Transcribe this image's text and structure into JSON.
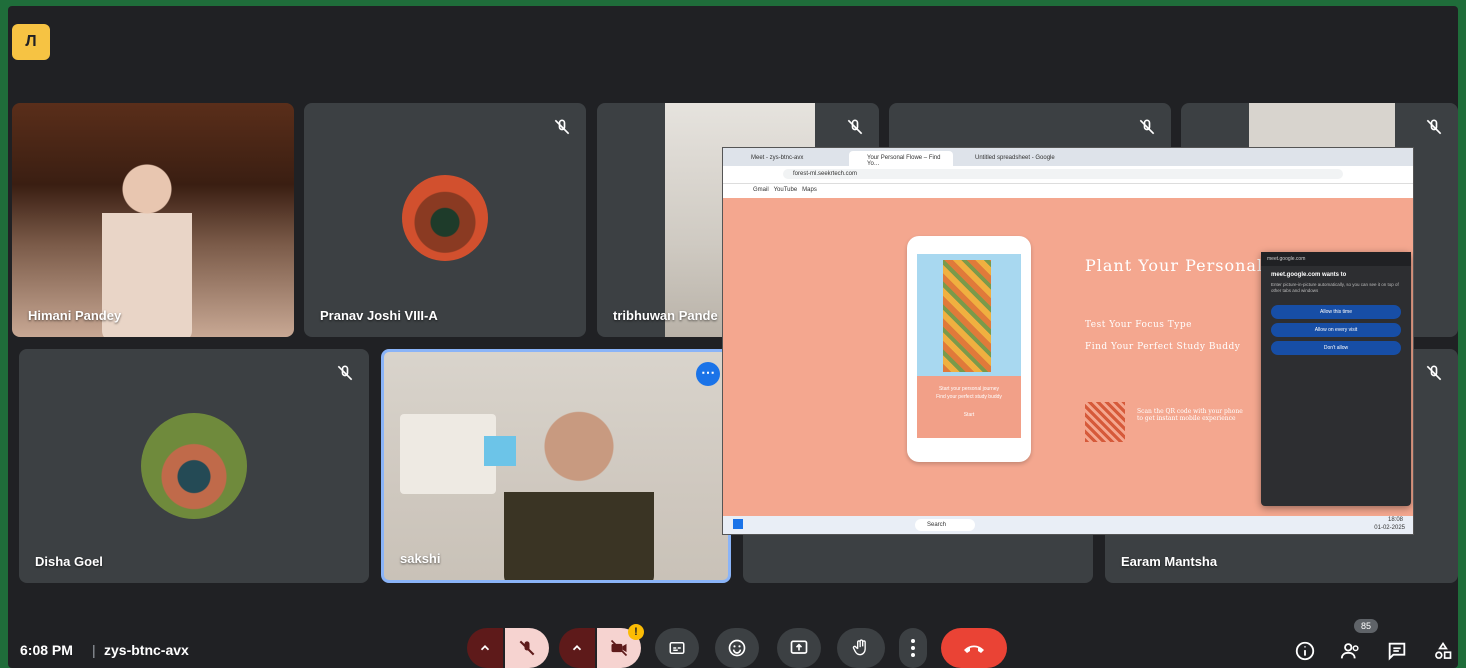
{
  "app": {
    "logo_text": "Л"
  },
  "participants": [
    {
      "name": "Himani Pandey",
      "muted": false
    },
    {
      "name": "Pranav Joshi VIII-A",
      "muted": true
    },
    {
      "name": "tribhuwan Pande",
      "muted": true
    },
    {
      "name": "",
      "muted": true
    },
    {
      "name": "",
      "muted": true
    },
    {
      "name": "Disha Goel",
      "muted": true
    },
    {
      "name": "sakshi",
      "muted": false,
      "active_speaker": true
    },
    {
      "name": "",
      "muted": false
    },
    {
      "name": "Earam Mantsha",
      "muted": true
    }
  ],
  "screen_share": {
    "tabs": [
      "Meet - zys-btnc-avx",
      "Your Personal Flowe – Find Yo…",
      "Untitled spreadsheet - Google"
    ],
    "address": "forest-ml.seekrtech.com",
    "bookmarks": [
      "Gmail",
      "YouTube",
      "Maps"
    ],
    "headline": "Plant Your Personal Flowe",
    "sub_lines": [
      "Test Your Focus Type",
      "Find Your Perfect Study Buddy"
    ],
    "qr_text": "Scan the QR code with your phone to get instant mobile experience",
    "phone_text": [
      "Start your personal journey",
      "Find your perfect study buddy",
      "Start"
    ],
    "taskbar_search": "Search",
    "taskbar_time": "18:08",
    "taskbar_date": "01-02-2025",
    "popup": {
      "header": "meet.google.com",
      "title": "meet.google.com wants to",
      "desc": "Enter picture-in-picture automatically, so you can see it on top of other tabs and windows",
      "buttons": [
        "Allow this time",
        "Allow on every visit",
        "Don't allow"
      ]
    }
  },
  "bottom": {
    "time": "6:08 PM",
    "separator": "|",
    "meeting_code": "zys-btnc-avx",
    "people_count": "85",
    "warning": "!"
  },
  "colors": {
    "end_call": "#ea4335",
    "accent": "#8ab4f8",
    "frame": "#202124",
    "tile": "#3c4043"
  }
}
